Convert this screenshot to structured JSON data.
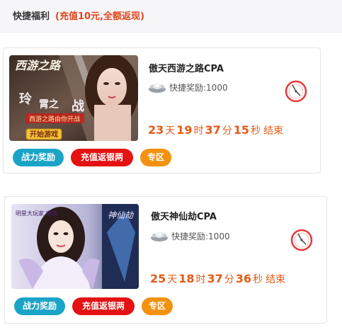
{
  "header": {
    "title": "快捷福利",
    "subtitle": "(充值10元,全额返现)"
  },
  "games": [
    {
      "name": "傲天西游之路CPA",
      "reward": "快捷奖励:1000",
      "banner_text": "西游之路由你开战",
      "banner_button": "开始游戏",
      "countdown": {
        "days": "23",
        "hours": "19",
        "minutes": "37",
        "seconds": "15"
      },
      "tags": [
        "战力奖励",
        "充值返银两",
        "专区"
      ]
    },
    {
      "name": "傲天神仙劫CPA",
      "reward": "快捷奖励:1000",
      "banner_text": "明星大玩家 唐嫣",
      "countdown": {
        "days": "25",
        "hours": "18",
        "minutes": "37",
        "seconds": "36"
      },
      "tags": [
        "战力奖励",
        "充值返银两",
        "专区"
      ]
    }
  ],
  "units": {
    "day": "天",
    "hour": "时",
    "minute": "分",
    "second": "秒",
    "end": "结束"
  },
  "colors": {
    "accent": "#e45b18",
    "power_tag": "#1aa4c7",
    "refund_tag": "#e41212",
    "zone_tag": "#f2920f"
  }
}
